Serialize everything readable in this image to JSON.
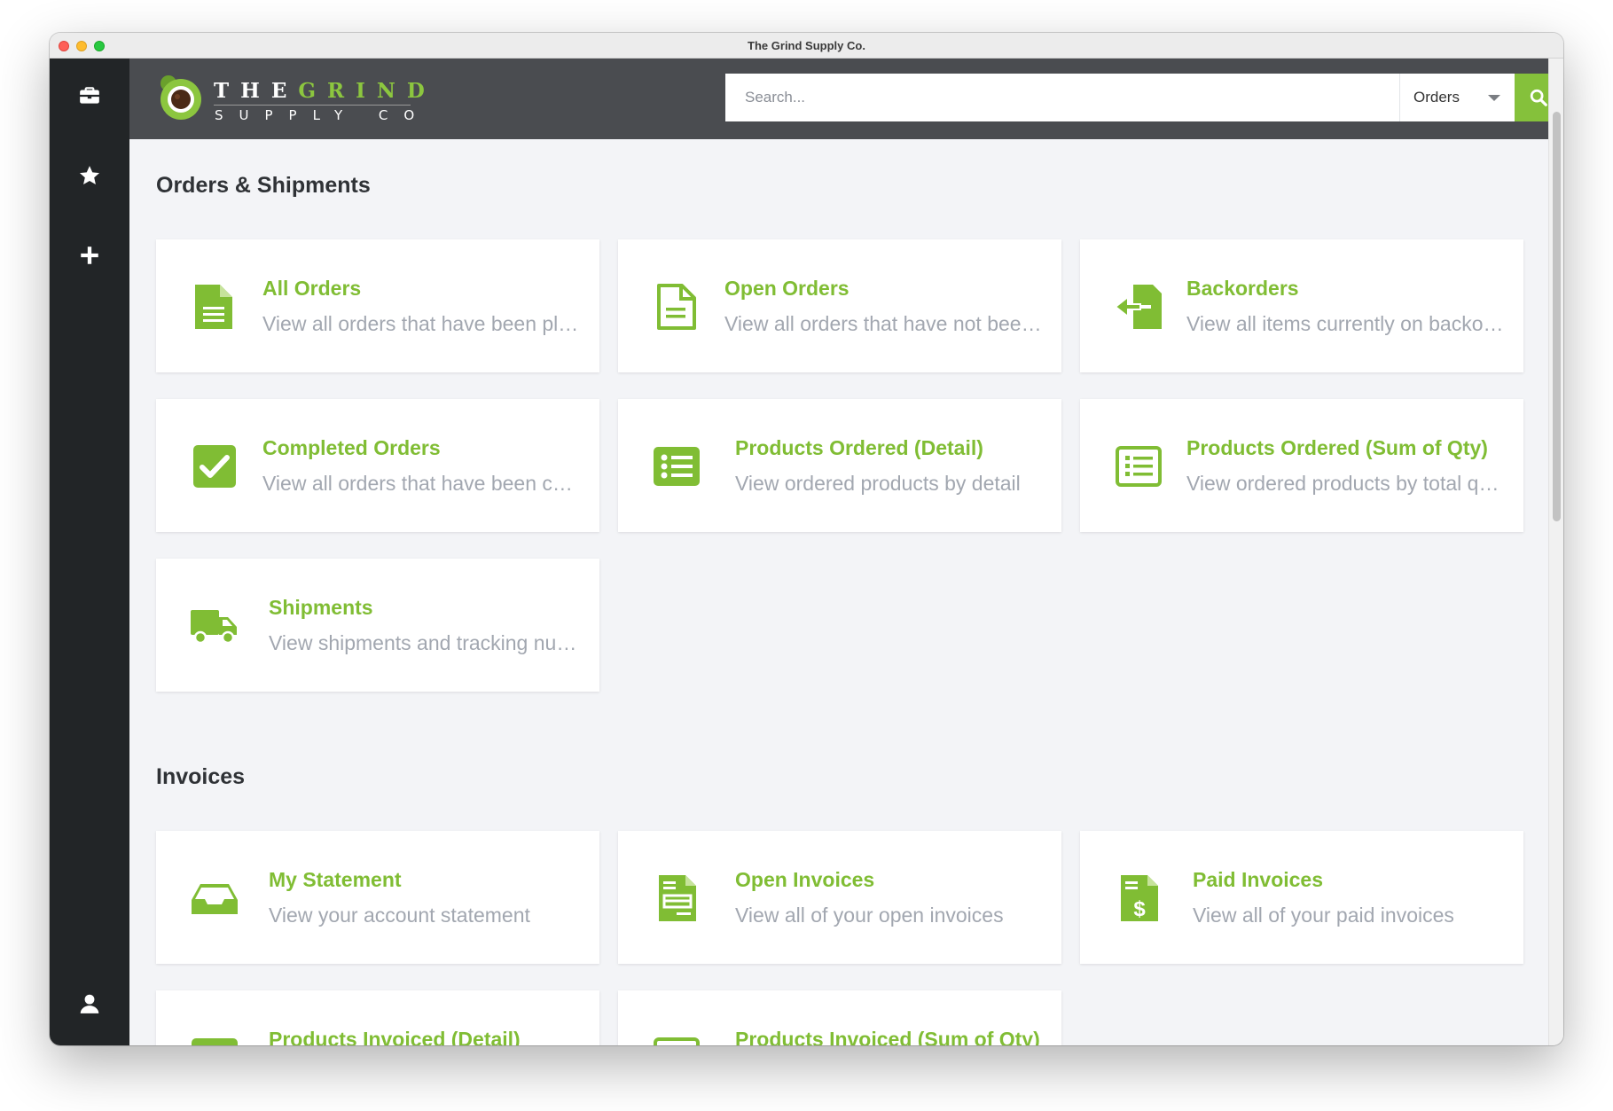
{
  "window": {
    "title": "The Grind Supply Co."
  },
  "logo": {
    "top_white": "THE",
    "top_green": "GRIND",
    "bottom": "SUPPLY CO"
  },
  "search": {
    "placeholder": "Search...",
    "scope": "Orders"
  },
  "colors": {
    "accent": "#80bd34",
    "topbar": "#4a4c50",
    "sidebar": "#222527",
    "background": "#f3f4f7"
  },
  "sidebar": {
    "icons": [
      "briefcase-icon",
      "star-icon",
      "plus-icon",
      "user-icon"
    ]
  },
  "sections": {
    "orders": {
      "title": "Orders & Shipments",
      "cards": [
        {
          "icon": "document-icon",
          "title": "All Orders",
          "desc": "View all orders that have been placed"
        },
        {
          "icon": "document-outline-icon",
          "title": "Open Orders",
          "desc": "View all orders that have not been shipped"
        },
        {
          "icon": "backorder-icon",
          "title": "Backorders",
          "desc": "View all items currently on backorder"
        },
        {
          "icon": "check-square-icon",
          "title": "Completed Orders",
          "desc": "View all orders that have been completed"
        },
        {
          "icon": "list-icon",
          "title": "Products Ordered (Detail)",
          "desc": "View ordered products by detail"
        },
        {
          "icon": "list-outline-icon",
          "title": "Products Ordered (Sum of Qty)",
          "desc": "View ordered products by total quantity"
        },
        {
          "icon": "truck-icon",
          "title": "Shipments",
          "desc": "View shipments and tracking numbers"
        }
      ]
    },
    "invoices": {
      "title": "Invoices",
      "cards": [
        {
          "icon": "inbox-icon",
          "title": "My Statement",
          "desc": "View your account statement"
        },
        {
          "icon": "invoice-icon",
          "title": "Open Invoices",
          "desc": "View all of your open invoices"
        },
        {
          "icon": "dollar-invoice-icon",
          "title": "Paid Invoices",
          "desc": "View all of your paid invoices"
        },
        {
          "icon": "list-icon",
          "title": "Products Invoiced (Detail)",
          "desc": ""
        },
        {
          "icon": "list-outline-icon",
          "title": "Products Invoiced (Sum of Qty)",
          "desc": ""
        }
      ]
    }
  }
}
